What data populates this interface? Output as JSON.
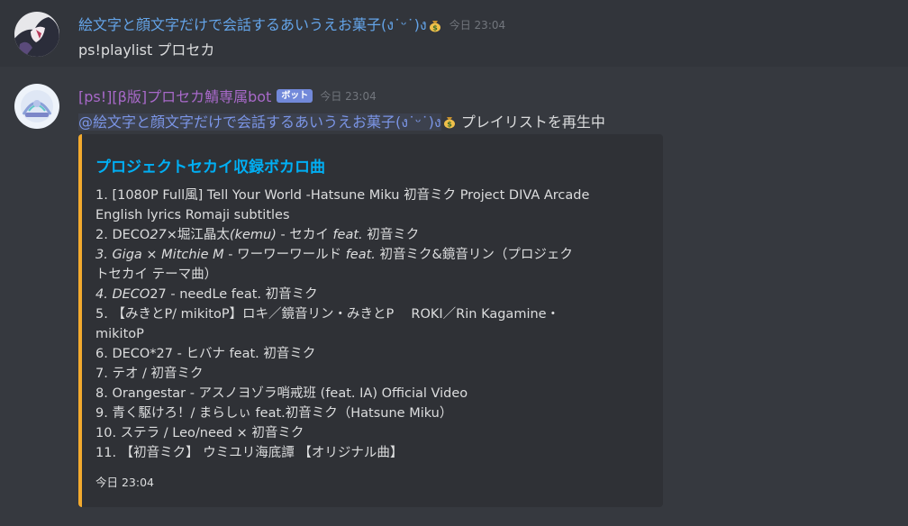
{
  "messages": [
    {
      "author": "絵文字と顔文字だけで会話するあいうえお菓子(ง˙ᵕ˙)ง",
      "author_emoji": "moneybag-icon",
      "timestamp": "今日 23:04",
      "content": "ps!playlist プロセカ"
    },
    {
      "author": "[ps!][β版]プロセカ鯖専属bot",
      "bot_tag": "ボット",
      "timestamp": "今日 23:04",
      "mention": "@絵文字と顔文字だけで会話するあいうえお菓子(ง˙ᵕ˙)ง",
      "mention_emoji": "moneybag-icon",
      "content_suffix": " プレイリストを再生中",
      "embed": {
        "accent_color": "#f3aa2e",
        "title": "プロジェクトセカイ収録ボカロ曲",
        "lines": {
          "l1a": "1. [1080P Full風] Tell Your World -Hatsune Miku 初音ミク Project DIVA Arcade",
          "l1b": "English lyrics Romaji subtitles",
          "l2_pre": "2. DECO",
          "l2_it1": "27",
          "l2_mid": "×堀江晶太",
          "l2_it2": "(kemu)",
          "l2_mid2": " - セカイ ",
          "l2_it3": "feat.",
          "l2_end": " 初音ミク",
          "l3_it1": "3. Giga × Mitchie M",
          "l3_mid": " - ワーワーワールド ",
          "l3_it2": "feat.",
          "l3_end": " 初音ミク&鏡音リン（プロジェク",
          "l3b": "トセカイ テーマ曲）",
          "l4_it": "4. DECO",
          "l4_end": "27 - needLe feat. 初音ミク",
          "l5a": "5. 【みきとP/ mikitoP】ロキ／鏡音リン・みきとP　 ROKI／Rin Kagamine・",
          "l5b": "mikitoP",
          "l6": "6. DECO*27 - ヒバナ feat. 初音ミク",
          "l7": "7. テオ / 初音ミク",
          "l8": "8. Orangestar - アスノヨゾラ哨戒班 (feat. IA) Official Video",
          "l9": "9. 青く駆けろ！/ まらしぃ feat.初音ミク（Hatsune Miku）",
          "l10": "10. ステラ / Leo/need × 初音ミク",
          "l11": "11. 【初音ミク】 ウミユリ海底譚 【オリジナル曲】"
        },
        "footer": "今日 23:04"
      }
    }
  ]
}
